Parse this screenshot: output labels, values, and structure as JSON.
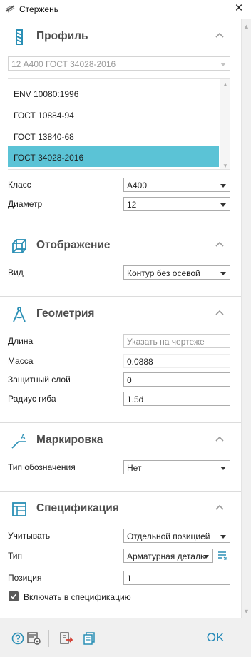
{
  "window": {
    "title": "Стержень",
    "close_symbol": "×"
  },
  "sections": {
    "profile": {
      "title": "Профиль",
      "standard_combo_value": "12 А400 ГОСТ 34028-2016",
      "standards": [
        "ENV 10080:1996",
        "ГОСТ 10884-94",
        "ГОСТ 13840-68",
        "ГОСТ 34028-2016"
      ],
      "selected_standard": "ГОСТ 34028-2016",
      "class_label": "Класс",
      "class_value": "А400",
      "diameter_label": "Диаметр",
      "diameter_value": "12"
    },
    "display": {
      "title": "Отображение",
      "view_label": "Вид",
      "view_value": "Контур без осевой"
    },
    "geometry": {
      "title": "Геометрия",
      "length_label": "Длина",
      "length_placeholder": "Указать на чертеже",
      "mass_label": "Масса",
      "mass_value": "0.0888",
      "cover_label": "Защитный слой",
      "cover_value": "0",
      "bend_radius_label": "Радиус гиба",
      "bend_radius_value": "1.5d"
    },
    "marking": {
      "title": "Маркировка",
      "designation_type_label": "Тип обозначения",
      "designation_type_value": "Нет"
    },
    "specification": {
      "title": "Спецификация",
      "account_label": "Учитывать",
      "account_value": "Отдельной позицией",
      "type_label": "Тип",
      "type_value": "Арматурная деталь",
      "position_label": "Позиция",
      "position_value": "1",
      "include_label": "Включать в спецификацию",
      "include_checked": true
    }
  },
  "footer": {
    "ok_label": "OK"
  },
  "colors": {
    "accent": "#2489b8",
    "selection": "#5bc3d6",
    "section_icon": "#2a8fb5"
  },
  "icons": [
    "rebar-icon",
    "chevron-up-icon",
    "cube-icon",
    "compass-icon",
    "marking-icon",
    "table-icon",
    "list-settings-icon",
    "help-icon",
    "settings-icon",
    "export-icon",
    "copy-icon"
  ]
}
